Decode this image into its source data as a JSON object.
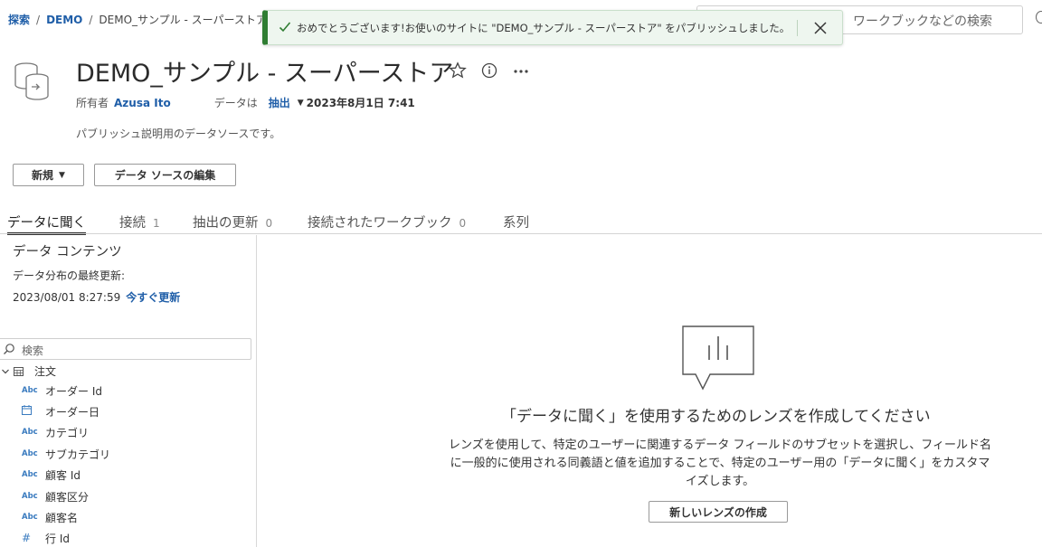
{
  "breadcrumb": {
    "explore": "探索",
    "sep1": "/",
    "project": "DEMO",
    "sep2": "/",
    "current": "DEMO_サンプル - スーパーストア"
  },
  "search": {
    "placeholder": "ワークブックなどの検索"
  },
  "toast": {
    "message": "おめでとうございます!お使いのサイトに \"DEMO_サンプル - スーパーストア\" をパブリッシュしました。"
  },
  "header": {
    "title": "DEMO_サンプル - スーパーストア",
    "owner_label": "所有者",
    "owner_name": "Azusa Ito",
    "data_label": "データは",
    "extract_label": "抽出",
    "extract_date": "2023年8月1日 7:41",
    "description": "パブリッシュ説明用のデータソースです。"
  },
  "buttons": {
    "new": "新規",
    "edit_datasource": "データ ソースの編集"
  },
  "tabs": [
    {
      "label": "データに聞く",
      "count": ""
    },
    {
      "label": "接続",
      "count": "1"
    },
    {
      "label": "抽出の更新",
      "count": "0"
    },
    {
      "label": "接続されたワークブック",
      "count": "0"
    },
    {
      "label": "系列",
      "count": ""
    }
  ],
  "panel": {
    "title": "データ コンテンツ",
    "last_update_label": "データ分布の最終更新:",
    "last_update_value": "2023/08/01 8:27:59",
    "refresh_now": "今すぐ更新",
    "search_placeholder": "検索",
    "table_name": "注文",
    "fields": [
      {
        "type": "Abc",
        "name": "オーダー Id"
      },
      {
        "type": "calendar",
        "name": "オーダー日"
      },
      {
        "type": "Abc",
        "name": "カテゴリ"
      },
      {
        "type": "Abc",
        "name": "サブカテゴリ"
      },
      {
        "type": "Abc",
        "name": "顧客 Id"
      },
      {
        "type": "Abc",
        "name": "顧客区分"
      },
      {
        "type": "Abc",
        "name": "顧客名"
      },
      {
        "type": "#",
        "name": "行 Id"
      }
    ]
  },
  "empty_state": {
    "title": "「データに聞く」を使用するためのレンズを作成してください",
    "description": "レンズを使用して、特定のユーザーに関連するデータ フィールドのサブセットを選択し、フィールド名に一般的に使用される同義語と値を追加することで、特定のユーザー用の「データに聞く」をカスタマイズします。",
    "button": "新しいレンズの作成"
  },
  "colors": {
    "link": "#1f5ea8",
    "success": "#2f7d32",
    "field_type": "#3a7bbf"
  }
}
